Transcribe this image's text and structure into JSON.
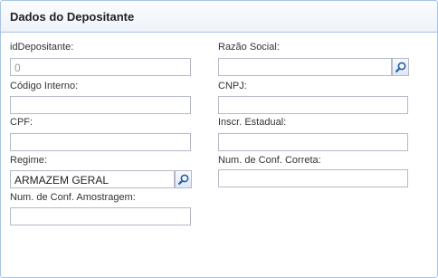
{
  "panel": {
    "title": "Dados do Depositante"
  },
  "fields": {
    "id_depositante": {
      "label": "idDepositante:",
      "value": "0"
    },
    "razao_social": {
      "label": "Razão Social:",
      "value": ""
    },
    "codigo_interno": {
      "label": "Código Interno:",
      "value": ""
    },
    "cnpj": {
      "label": "CNPJ:",
      "value": ""
    },
    "cpf": {
      "label": "CPF:",
      "value": ""
    },
    "inscr_estadual": {
      "label": "Inscr. Estadual:",
      "value": ""
    },
    "regime": {
      "label": "Regime:",
      "value": "ARMAZEM GERAL"
    },
    "num_conf_correta": {
      "label": "Num. de Conf. Correta:",
      "value": ""
    },
    "num_conf_amostragem": {
      "label": "Num. de Conf. Amostragem:",
      "value": ""
    }
  },
  "icons": {
    "lookup": "magnifier-icon"
  },
  "colors": {
    "border": "#a8c3e6",
    "field_border": "#b5b8c8",
    "icon": "#1f5fa8"
  }
}
